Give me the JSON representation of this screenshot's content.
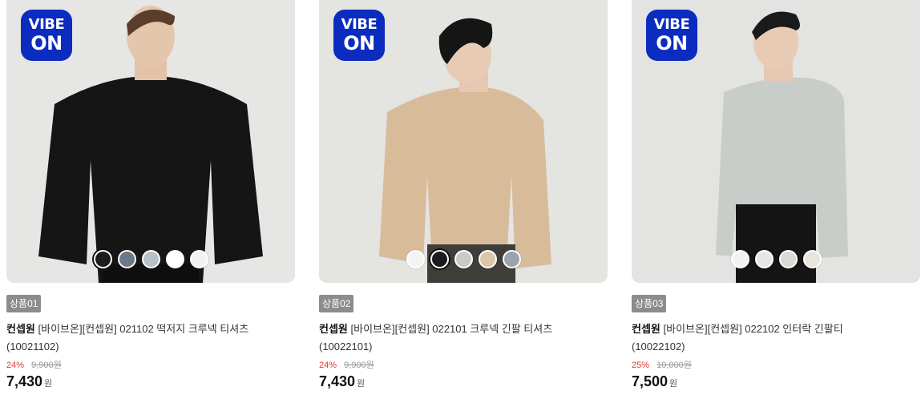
{
  "badge": {
    "line1": "VIBE",
    "line2": "ON"
  },
  "products": [
    {
      "tag": "상품01",
      "brand": "컨셉원",
      "title": "[바이브온][컨셉원] 021102 떡저지 크루넥 티셔츠",
      "title_line2": "(10021102)",
      "discount": "24%",
      "original_price": "9,900원",
      "price": "7,430",
      "currency": "원",
      "swatch_colors": [
        "#1c1c1e",
        "#6b7887",
        "#b9c1c8",
        "#ffffff",
        "#f2f2f2"
      ],
      "selected_swatch": 0,
      "garment_color": "#151515"
    },
    {
      "tag": "상품02",
      "brand": "컨셉원",
      "title": "[바이브온][컨셉원] 022101 크루넥 긴팔 티셔츠",
      "title_line2": "(10022101)",
      "discount": "24%",
      "original_price": "9,900원",
      "price": "7,430",
      "currency": "원",
      "swatch_colors": [
        "#f4f4f4",
        "#1c1c1e",
        "#c9c9c9",
        "#dcc5a8",
        "#9aa3ad"
      ],
      "selected_swatch": 1,
      "garment_color": "#d8bc9a"
    },
    {
      "tag": "상품03",
      "brand": "컨셉원",
      "title": "[바이브온][컨셉원] 022102 인터락 긴팔티 (10022102)",
      "title_line2": "",
      "discount": "25%",
      "original_price": "10,000원",
      "price": "7,500",
      "currency": "원",
      "swatch_colors": [
        "#f2f2f2",
        "#1c1c1e",
        "#d9d9d6",
        "#e9e5db"
      ],
      "selected_swatch": 1,
      "garment_color": "#c9cdca"
    }
  ]
}
